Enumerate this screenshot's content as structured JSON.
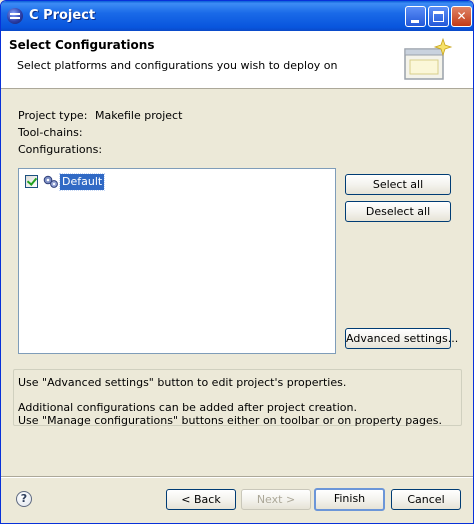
{
  "window": {
    "title": "C Project",
    "minimize_icon": "minimize-icon",
    "maximize_icon": "maximize-icon",
    "close_glyph": "✕"
  },
  "header": {
    "title": "Select Configurations",
    "description": "Select platforms and configurations you wish to deploy on",
    "art_icon": "wizard-banner-icon"
  },
  "fields": {
    "project_type_label": "Project type:",
    "project_type_value": "Makefile project",
    "toolchains_label": "Tool-chains:",
    "configurations_label": "Configurations:"
  },
  "configurations": [
    {
      "label": "Default",
      "checked": true,
      "selected": true,
      "icon": "configuration-gear-icon"
    }
  ],
  "side_buttons": {
    "select_all": "Select all",
    "deselect_all": "Deselect all",
    "advanced": "Advanced settings..."
  },
  "info": {
    "line1": "Use \"Advanced settings\" button to edit project's properties.",
    "line2": "Additional configurations can be added after project creation.",
    "line3": "Use \"Manage configurations\" buttons either on toolbar or on property pages."
  },
  "footer": {
    "help_glyph": "?",
    "back": "< Back",
    "next": "Next >",
    "finish": "Finish",
    "cancel": "Cancel",
    "next_enabled": false
  },
  "colors": {
    "titlebar": "#0855dd",
    "selection": "#316ac5",
    "dialog_bg": "#ece9d8",
    "check": "#21a121"
  }
}
